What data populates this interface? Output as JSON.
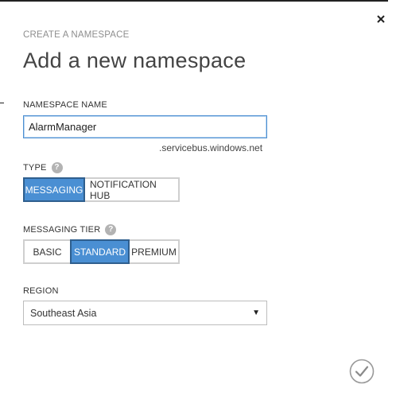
{
  "breadcrumb": "CREATE A NAMESPACE",
  "title": "Add a new namespace",
  "namespace": {
    "label": "NAMESPACE NAME",
    "value": "AlarmManager",
    "suffix": ".servicebus.windows.net"
  },
  "type": {
    "label": "TYPE",
    "options": [
      "MESSAGING",
      "NOTIFICATION HUB"
    ],
    "selected": "MESSAGING"
  },
  "tier": {
    "label": "MESSAGING TIER",
    "options": [
      "BASIC",
      "STANDARD",
      "PREMIUM"
    ],
    "selected": "STANDARD"
  },
  "region": {
    "label": "REGION",
    "value": "Southeast Asia"
  },
  "help_glyph": "?",
  "icons": {
    "close": "close-icon",
    "confirm": "checkmark-icon",
    "help": "help-icon",
    "dropdown": "chevron-down-icon"
  },
  "colors": {
    "accent": "#4a8fd3",
    "accent_border": "#2f5f8e",
    "input_focus": "#4d8fd1"
  }
}
